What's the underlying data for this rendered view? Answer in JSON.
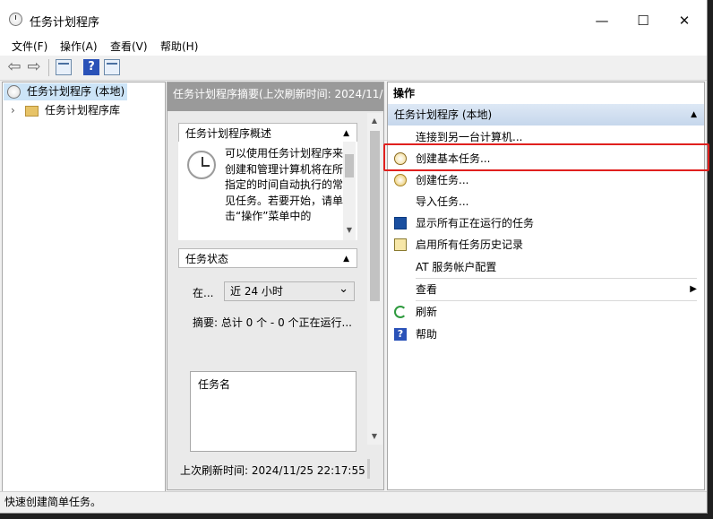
{
  "window": {
    "title": "任务计划程序",
    "controls": {
      "minimize": "—",
      "maximize": "☐",
      "close": "✕"
    }
  },
  "menu": [
    "文件(F)",
    "操作(A)",
    "查看(V)",
    "帮助(H)"
  ],
  "toolbar": {
    "back": "⇦",
    "forward": "⇨",
    "help": "?"
  },
  "tree": {
    "root": "任务计划程序 (本地)",
    "child": "任务计划程序库",
    "expander": "›"
  },
  "middle": {
    "header": "任务计划程序摘要(上次刷新时间: 2024/11/",
    "overview_title": "任务计划程序概述",
    "overview_text": "可以使用任务计划程序来创建和管理计算机将在所指定的时间自动执行的常见任务。若要开始，请单击“操作”菜单中的",
    "status_title": "任务状态",
    "in_label": "在...",
    "period": "近 24 小时",
    "summary": "摘要: 总计 0 个 - 0 个正在运行...",
    "task_name_col": "任务名",
    "last_refresh": "上次刷新时间: 2024/11/25 22:17:55",
    "collapse_glyph": "▲",
    "dropdown_glyph": "⌄"
  },
  "actions": {
    "title": "操作",
    "group": "任务计划程序 (本地)",
    "group_glyph": "▲",
    "items": [
      {
        "label": "连接到另一台计算机...",
        "icon": "none"
      },
      {
        "label": "创建基本任务...",
        "icon": "clock-task-icon"
      },
      {
        "label": "创建任务...",
        "icon": "task-icon"
      },
      {
        "label": "导入任务...",
        "icon": "none"
      },
      {
        "label": "显示所有正在运行的任务",
        "icon": "running-tasks-icon"
      },
      {
        "label": "启用所有任务历史记录",
        "icon": "history-log-icon"
      },
      {
        "label": "AT 服务帐户配置",
        "icon": "none"
      },
      {
        "label": "查看",
        "icon": "none",
        "submenu": "▶"
      },
      {
        "label": "刷新",
        "icon": "refresh-icon"
      },
      {
        "label": "帮助",
        "icon": "help-icon"
      }
    ]
  },
  "statusbar": "快速创建简单任务。",
  "colors": {
    "highlight": "#e0201e",
    "group_bg": "#c6d7ec",
    "mid_header": "#9a9a9a"
  }
}
